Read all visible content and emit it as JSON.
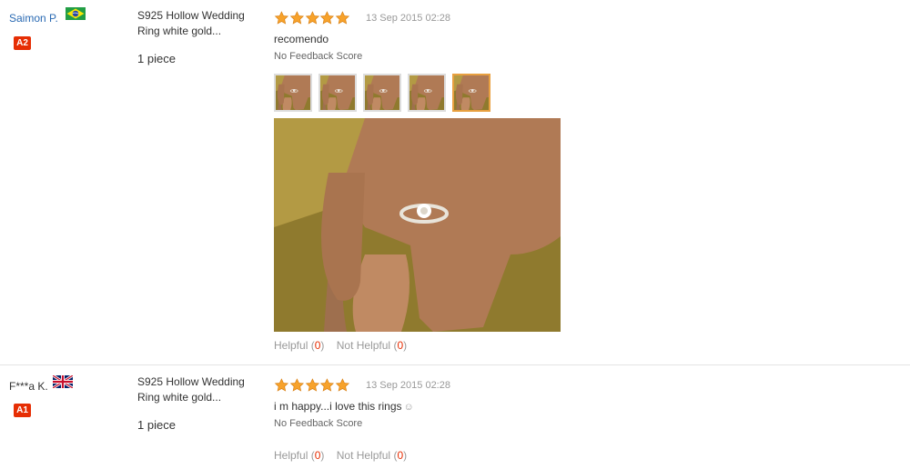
{
  "reviews": [
    {
      "user_name": "Saimon P.",
      "country_flag": "brazil-flag-icon",
      "level": "A2",
      "product_name": "S925 Hollow Wedding Ring white gold...",
      "quantity": "1 piece",
      "rating": 5,
      "date": "13 Sep 2015 02:28",
      "text": "recomendo",
      "feedback": "No Feedback Score",
      "photo_count": 5,
      "helpful_label": "Helpful",
      "helpful_count": "0",
      "not_helpful_label": "Not Helpful",
      "not_helpful_count": "0"
    },
    {
      "user_name": "F***a K.",
      "country_flag": "uk-flag-icon",
      "level": "A1",
      "product_name": "S925 Hollow Wedding Ring white gold...",
      "quantity": "1 piece",
      "rating": 5,
      "date": "13 Sep 2015 02:28",
      "text": "i m happy...i love this rings",
      "feedback": "No Feedback Score",
      "helpful_label": "Helpful",
      "helpful_count": "0",
      "not_helpful_label": "Not Helpful",
      "not_helpful_count": "0"
    }
  ],
  "colors": {
    "link": "#2a6ab3",
    "star": "#f7a22b",
    "badge": "#e62e04",
    "count": "#e62e04",
    "muted": "#999999"
  }
}
